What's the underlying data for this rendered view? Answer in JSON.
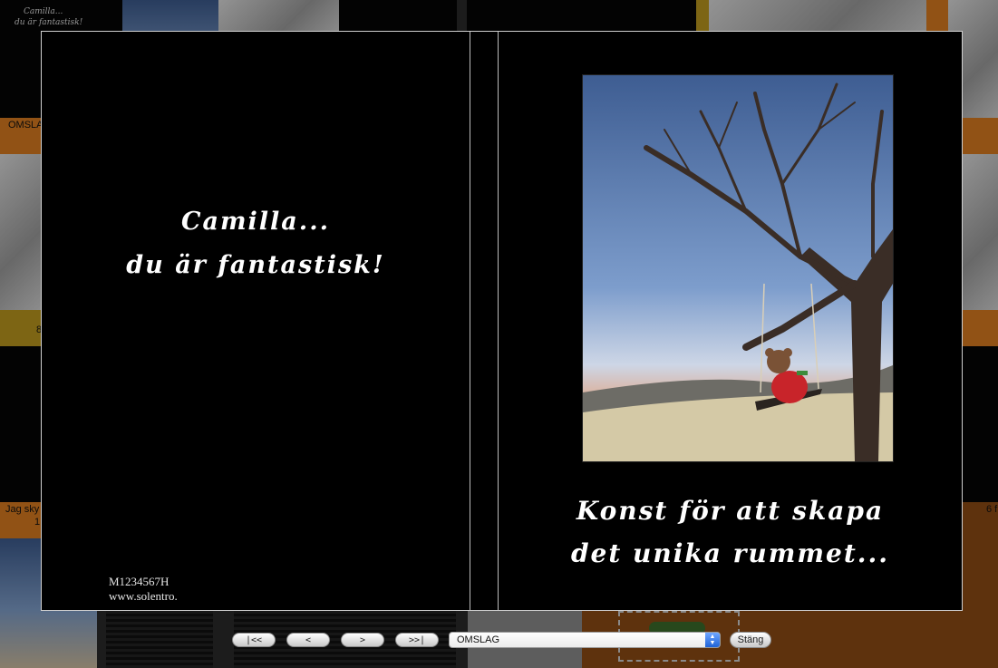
{
  "background": {
    "thumb_title_line1": "Camilla...",
    "thumb_title_line2": "du är fantastisk!",
    "label_cover": "OMSLAG",
    "label_a": "8",
    "label_b": "Jag sky",
    "label_c": "1",
    "label_d": "6 f"
  },
  "spread": {
    "left_title_line1": "Camilla...",
    "left_title_line2": "du är fantastisk!",
    "left_code_line1": "M1234567H",
    "left_code_line2": "www.solentro.",
    "right_tagline_line1": "Konst för att skapa",
    "right_tagline_line2": "det unika rummet..."
  },
  "controls": {
    "first_label": "|<<",
    "prev_label": "<",
    "next_label": ">",
    "last_label": ">>|",
    "page_select_value": "OMSLAG",
    "close_label": "Stäng"
  },
  "colors": {
    "orange": "#d67a1f",
    "brown": "#8b4a14",
    "gold": "#b8961e",
    "sky_top": "#3c5a8c",
    "sky_bottom": "#b9c9e0"
  }
}
